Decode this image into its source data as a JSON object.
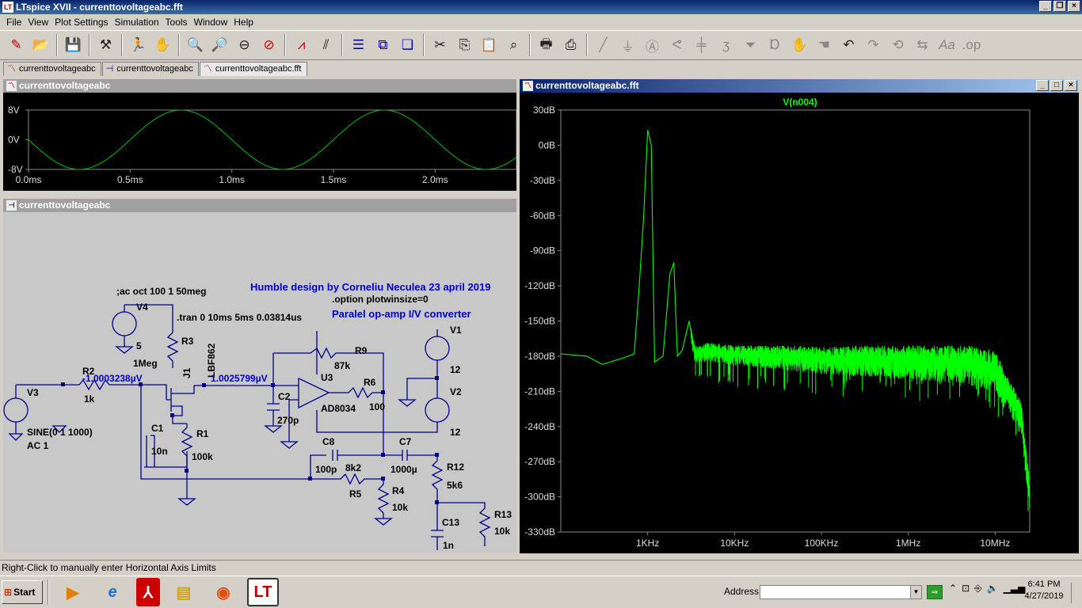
{
  "window": {
    "title": "LTspice XVII - currenttovoltageabc.fft"
  },
  "menu": [
    "File",
    "View",
    "Plot Settings",
    "Simulation",
    "Tools",
    "Window",
    "Help"
  ],
  "toolbar_icons": [
    "new-schematic",
    "open",
    "save",
    "control-panel",
    "run",
    "halt",
    "zoom-in",
    "zoom-pan",
    "zoom-out",
    "zoom-cancel",
    "autorange",
    "view-netlist",
    "tile-horizontal",
    "tile-vertical",
    "cascade",
    "cut",
    "copy",
    "paste",
    "find",
    "print-setup",
    "print",
    "draw-wire",
    "ground",
    "label-net",
    "resistor",
    "capacitor",
    "inductor",
    "diode",
    "component",
    "drag",
    "move",
    "undo",
    "redo",
    "rotate",
    "mirror",
    "text",
    "spice-directive"
  ],
  "tabs": [
    {
      "label": "currenttovoltageabc",
      "icon": "waveform-icon"
    },
    {
      "label": "currenttovoltageabc",
      "icon": "schematic-icon"
    },
    {
      "label": "currenttovoltageabc.fft",
      "icon": "waveform-icon"
    }
  ],
  "windows": {
    "transient": {
      "title": "currenttovoltageabc"
    },
    "schematic": {
      "title": "currenttovoltageabc"
    },
    "fft": {
      "title": "currenttovoltageabc.fft"
    }
  },
  "transient_plot": {
    "y_ticks": [
      "8V",
      "0V",
      "-8V"
    ],
    "x_ticks": [
      "0.0ms",
      "0.5ms",
      "1.0ms",
      "1.5ms",
      "2.0ms"
    ]
  },
  "schematic": {
    "texts": {
      "humble": "Humble design by Corneliu Neculea 23 april 2019",
      "option": ".option plotwinsize=0",
      "paralel": "Paralel op-amp I/V converter",
      "ac": ";ac oct 100 1 50meg",
      "tran": ".tran 0 10ms 5ms 0.03814us",
      "v4": "V4",
      "v4val": "5",
      "r3": "R3",
      "r3val": "1Meg",
      "j1": "J1",
      "lbf": "LBF862",
      "r2": "R2",
      "r2val": "1k",
      "probe1": "-1.0003238µV",
      "probe2": "1.0025799µV",
      "v3": "V3",
      "sine": "SINE(0 1 1000)",
      "ac1": "AC 1",
      "c1": "C1",
      "c1val": "10n",
      "r1": "R1",
      "r1val": "100k",
      "c2": "C2",
      "c2val": "270p",
      "r9": "R9",
      "r9val": "87k",
      "u3": "U3",
      "u3val": "AD8034",
      "r6": "R6",
      "r6val": "100",
      "v1": "V1",
      "v1val": "12",
      "v2": "V2",
      "v2val": "12",
      "c8": "C8",
      "c8val": "100p",
      "r5": "R5",
      "r5val": "8k2",
      "c7": "C7",
      "c7val": "1000µ",
      "r4": "R4",
      "r4val": "10k",
      "r12": "R12",
      "r12val": "5k6",
      "c13": "C13",
      "c13val": "1n",
      "r13": "R13",
      "r13val": "10k"
    }
  },
  "chart_data": [
    {
      "type": "line",
      "title": "",
      "series": [
        {
          "name": "",
          "color": "#00ff00"
        }
      ],
      "x_unit": "ms",
      "xlim": [
        0.0,
        2.4
      ],
      "ylim": [
        -8,
        8
      ],
      "signal": {
        "amplitude_V": 8,
        "frequency_Hz": 1000,
        "phase": "sine, starts at 0 V descending"
      },
      "x_ticks": [
        "0.0ms",
        "0.5ms",
        "1.0ms",
        "1.5ms",
        "2.0ms"
      ],
      "y_ticks": [
        "8V",
        "0V",
        "-8V"
      ],
      "grid": false,
      "background": "#000000"
    },
    {
      "type": "line",
      "title": "V(n004)",
      "series": [
        {
          "name": "V(n004)",
          "color": "#00ff00",
          "x": [
            100,
            200,
            300,
            500,
            700,
            800,
            900,
            1000,
            1100,
            1200,
            1500,
            1800,
            2000,
            2200,
            2500,
            3000,
            3500,
            5000,
            10000,
            50000,
            100000,
            300000,
            1000000,
            5000000,
            10000000,
            20000000,
            25000000
          ],
          "y": [
            -178,
            -180,
            -187,
            -182,
            -178,
            -120,
            -60,
            13,
            0,
            -185,
            -180,
            -110,
            -100,
            -180,
            -175,
            -150,
            -178,
            -175,
            -178,
            -180,
            -182,
            -182,
            -183,
            -185,
            -190,
            -230,
            -300
          ]
        }
      ],
      "x_scale": "log",
      "xlim": [
        100,
        25000000
      ],
      "ylim": [
        -330,
        30
      ],
      "x_ticks": [
        "1KHz",
        "10KHz",
        "100KHz",
        "1MHz",
        "10MHz"
      ],
      "y_ticks": [
        "30dB",
        "0dB",
        "-30dB",
        "-60dB",
        "-90dB",
        "-120dB",
        "-150dB",
        "-180dB",
        "-210dB",
        "-240dB",
        "-270dB",
        "-300dB",
        "-330dB"
      ],
      "grid": false,
      "background": "#000000"
    }
  ],
  "status": {
    "text": "Right-Click to manually enter Horizontal Axis Limits"
  },
  "taskbar": {
    "start": "Start",
    "address_label": "Address",
    "address_value": "",
    "time": "6:41 PM",
    "date": "4/27/2019",
    "apps": [
      "media-player-icon",
      "ie-icon",
      "acrobat-icon",
      "explorer-icon",
      "firefox-icon",
      "ltspice-icon"
    ]
  }
}
